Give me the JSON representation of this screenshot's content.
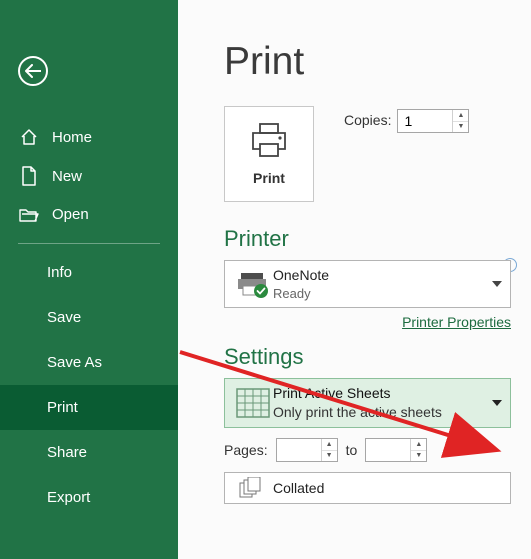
{
  "sidebar": {
    "top": [
      {
        "icon": "home",
        "label": "Home"
      },
      {
        "icon": "new",
        "label": "New"
      },
      {
        "icon": "open",
        "label": "Open"
      }
    ],
    "items": [
      {
        "label": "Info"
      },
      {
        "label": "Save"
      },
      {
        "label": "Save As"
      },
      {
        "label": "Print",
        "active": true
      },
      {
        "label": "Share"
      },
      {
        "label": "Export"
      }
    ]
  },
  "title": "Print",
  "print_button": "Print",
  "copies": {
    "label": "Copies:",
    "value": "1"
  },
  "printer": {
    "heading": "Printer",
    "name": "OneNote",
    "status": "Ready",
    "properties_link": "Printer Properties"
  },
  "settings": {
    "heading": "Settings",
    "scope": {
      "title": "Print Active Sheets",
      "subtitle": "Only print the active sheets"
    },
    "pages": {
      "label": "Pages:",
      "from": "",
      "to_label": "to",
      "to": ""
    },
    "collate": {
      "label": "Collated"
    }
  }
}
